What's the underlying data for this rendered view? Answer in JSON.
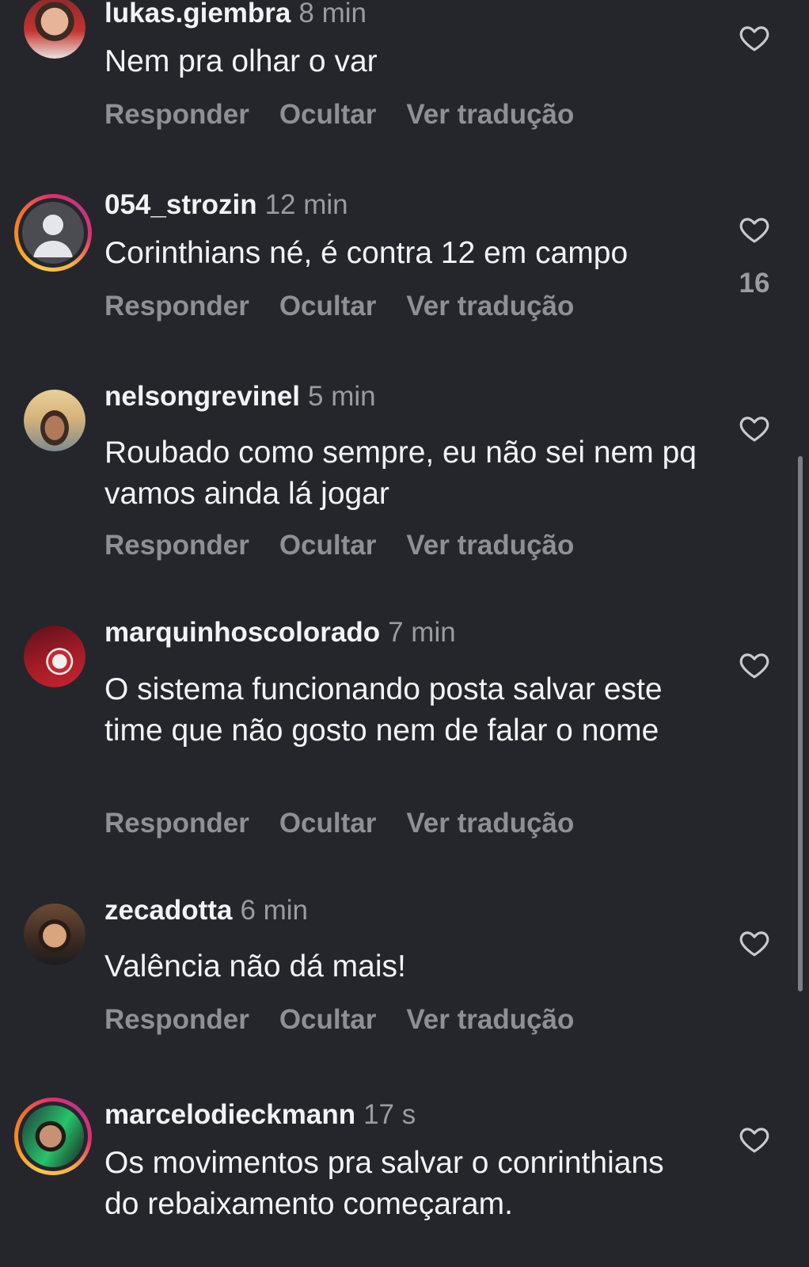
{
  "comments": [
    {
      "username": "lukas.giembra",
      "time": "8 min",
      "text": "Nem pra olhar o var",
      "actions": {
        "reply": "Responder",
        "hide": "Ocultar",
        "translate": "Ver tradução"
      },
      "like_icon": "heart-outline-icon",
      "has_story_ring": false
    },
    {
      "username": "054_strozin",
      "time": "12 min",
      "text": "Corinthians né, é contra 12 em campo",
      "actions": {
        "reply": "Responder",
        "hide": "Ocultar",
        "translate": "Ver tradução"
      },
      "like_icon": "heart-outline-icon",
      "like_count": "16",
      "has_story_ring": true
    },
    {
      "username": "nelsongrevinel",
      "time": "5 min",
      "text": "Roubado como sempre, eu não sei nem pq vamos ainda lá jogar",
      "actions": {
        "reply": "Responder",
        "hide": "Ocultar",
        "translate": "Ver tradução"
      },
      "like_icon": "heart-outline-icon",
      "has_story_ring": false
    },
    {
      "username": "marquinhoscolorado",
      "time": "7 min",
      "text": "O sistema funcionando posta salvar este time que não gosto nem de falar o nome",
      "actions": {
        "reply": "Responder",
        "hide": "Ocultar",
        "translate": "Ver tradução"
      },
      "like_icon": "heart-outline-icon",
      "has_story_ring": false
    },
    {
      "username": "zecadotta",
      "time": "6 min",
      "text": "Valência não dá mais!",
      "actions": {
        "reply": "Responder",
        "hide": "Ocultar",
        "translate": "Ver tradução"
      },
      "like_icon": "heart-outline-icon",
      "has_story_ring": false
    },
    {
      "username": "marcelodieckmann",
      "time": "17 s",
      "text": "Os movimentos pra salvar o conrinthians do rebaixamento começaram.",
      "like_icon": "heart-outline-icon",
      "has_story_ring": true
    }
  ],
  "colors": {
    "background": "#24262b",
    "primary_text": "#f2f3f5",
    "secondary_text": "#9a9ca2",
    "action_text": "#8e9096",
    "story_ring": [
      "#f9c74f",
      "#e1306c",
      "#c13584"
    ]
  }
}
